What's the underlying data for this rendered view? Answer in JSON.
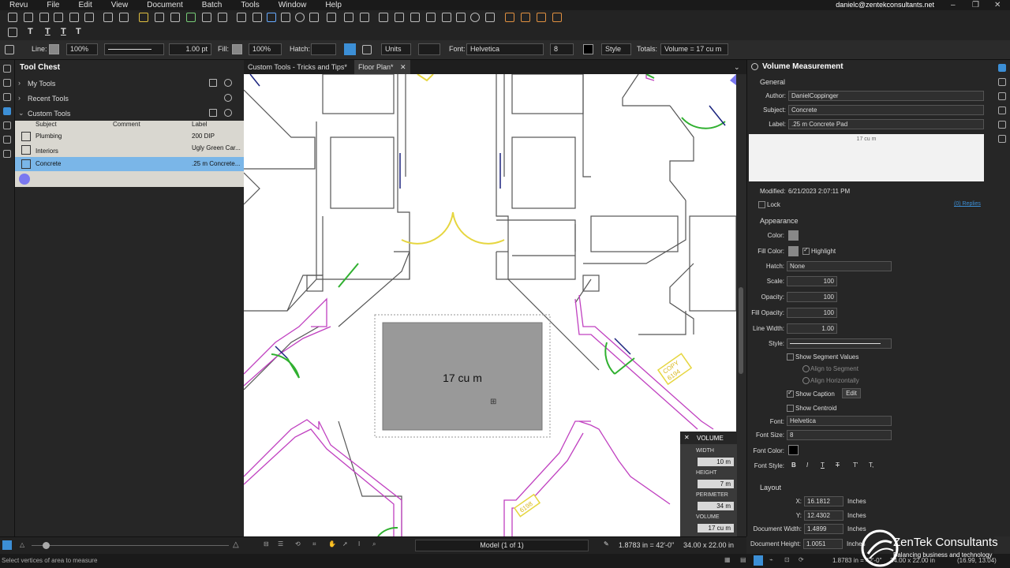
{
  "menu": {
    "items": [
      "Revu",
      "File",
      "Edit",
      "View",
      "Document",
      "Batch",
      "Tools",
      "Window",
      "Help"
    ],
    "user_email": "danielc@zentekconsultants.net"
  },
  "toolbar_text": {
    "t1": "T",
    "t2": "T",
    "t3": "T",
    "t4": "T"
  },
  "properties_bar": {
    "line_label": "Line:",
    "line_opacity": "100%",
    "line_width": "1.00 pt",
    "fill_label": "Fill:",
    "fill_opacity": "100%",
    "hatch_label": "Hatch:",
    "units_value": "Units",
    "font_label": "Font:",
    "font_value": "Helvetica",
    "font_size": "8",
    "style_value": "Style",
    "totals_label": "Totals:",
    "totals_value": "Volume = 17 cu m"
  },
  "tool_chest": {
    "title": "Tool Chest",
    "sections": [
      "My Tools",
      "Recent Tools",
      "Custom Tools"
    ],
    "columns": [
      "Subject",
      "Comment",
      "Label"
    ],
    "rows": [
      {
        "subject": "Plumbing",
        "comment": "",
        "label": "200 DIP"
      },
      {
        "subject": "Interiors",
        "comment": "",
        "label": "Ugly Green Car..."
      },
      {
        "subject": "Concrete",
        "comment": "",
        "label": ".25 m Concrete..."
      }
    ]
  },
  "tabs": [
    {
      "label": "Custom Tools - Tricks and Tips*"
    },
    {
      "label": "Floor Plan*"
    }
  ],
  "canvas": {
    "markup_caption": "17 cu m",
    "tag_1": "COPY",
    "tag_1b": "6194",
    "tag_2": "6198"
  },
  "volume_popup": {
    "title": "VOLUME",
    "width_label": "WIDTH",
    "width_value": "10 m",
    "height_label": "HEIGHT",
    "height_value": "7 m",
    "perimeter_label": "PERIMETER",
    "perimeter_value": "34 m",
    "volume_label": "VOLUME",
    "volume_value": "17 cu m"
  },
  "properties_panel": {
    "title": "Volume Measurement",
    "general_label": "General",
    "author_label": "Author:",
    "author_value": "DanielCoppinger",
    "subject_label": "Subject:",
    "subject_value": "Concrete",
    "label_label": "Label:",
    "label_value": ".25 m Concrete Pad",
    "comment_preview": "17 cu m",
    "modified_label": "Modified:",
    "modified_value": "6/21/2023 2:07:11 PM",
    "lock_label": "Lock",
    "replies_link": "(0) Replies",
    "appearance_label": "Appearance",
    "color_label": "Color:",
    "fill_color_label": "Fill Color:",
    "highlight_label": "Highlight",
    "hatch_label": "Hatch:",
    "hatch_value": "None",
    "scale_label": "Scale:",
    "scale_value": "100",
    "opacity_label": "Opacity:",
    "opacity_value": "100",
    "fill_opacity_label": "Fill Opacity:",
    "fill_opacity_value": "100",
    "line_width_label": "Line Width:",
    "line_width_value": "1.00",
    "style_label": "Style:",
    "show_segment_values": "Show Segment Values",
    "align_to_segment": "Align to Segment",
    "align_horizontally": "Align Horizontally",
    "show_caption": "Show Caption",
    "edit_button": "Edit",
    "show_centroid": "Show Centroid",
    "font_label": "Font:",
    "font_value": "Helvetica",
    "font_size_label": "Font Size:",
    "font_size_value": "8",
    "font_color_label": "Font Color:",
    "font_style_label": "Font Style:",
    "layout_label": "Layout",
    "x_label": "X:",
    "x_value": "16.1812",
    "x_unit": "Inches",
    "y_label": "Y:",
    "y_value": "12.4302",
    "y_unit": "Inches",
    "doc_width_label": "Document Width:",
    "doc_width_value": "1.4899",
    "doc_width_unit": "Inches",
    "doc_height_label": "Document Height:",
    "doc_height_value": "1.0051",
    "doc_height_unit": "Inches"
  },
  "bottom_bar": {
    "page_label": "Model (1 of 1)",
    "measure_readout": "1.8783 in = 42'-0\"",
    "dimensions": "34.00 x 22.00 in",
    "status_hint": "Select vertices of area to measure",
    "status_right_1": "1.8783 in = 42'-0\"",
    "status_right_2": "34.00 x 22.00 in",
    "coords": "(16.99, 13.04)"
  },
  "branding": {
    "name": "ZenTek Consultants",
    "tagline": "Balancing business and technology"
  },
  "colors": {
    "accent": "#3c8fd6",
    "selection": "#7ab6e8",
    "magenta": "#c040c0",
    "green": "#30b030",
    "yellow": "#e6d640",
    "navy": "#1a237e"
  }
}
